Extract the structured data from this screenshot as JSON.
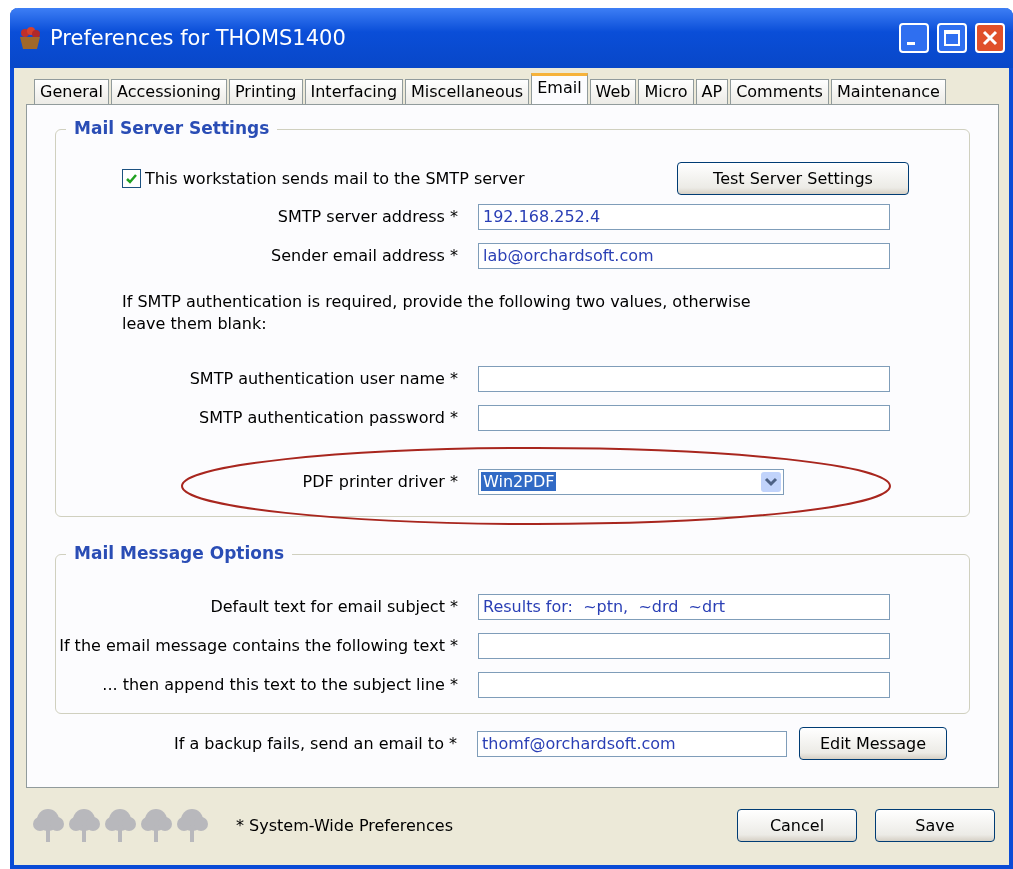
{
  "window": {
    "title": "Preferences for THOMS1400"
  },
  "tabs": [
    {
      "label": "General",
      "selected": false
    },
    {
      "label": "Accessioning",
      "selected": false
    },
    {
      "label": "Printing",
      "selected": false
    },
    {
      "label": "Interfacing",
      "selected": false
    },
    {
      "label": "Miscellaneous",
      "selected": false
    },
    {
      "label": "Email",
      "selected": true
    },
    {
      "label": "Web",
      "selected": false
    },
    {
      "label": "Micro",
      "selected": false
    },
    {
      "label": "AP",
      "selected": false
    },
    {
      "label": "Comments",
      "selected": false
    },
    {
      "label": "Maintenance",
      "selected": false
    }
  ],
  "mail_server_settings": {
    "title": "Mail Server Settings",
    "sends_mail": {
      "label": "This workstation sends mail to the SMTP server",
      "checked": true
    },
    "test_button": "Test Server Settings",
    "fields": [
      {
        "label": "SMTP server address *",
        "value": "192.168.252.4"
      },
      {
        "label": "Sender email address *",
        "value": "lab@orchardsoft.com"
      }
    ],
    "note": "If SMTP authentication is required, provide the following two values, otherwise leave them blank:",
    "auth_fields": [
      {
        "label": "SMTP authentication user name *"
      },
      {
        "label": "SMTP authentication password *"
      }
    ],
    "pdf_driver": {
      "label": "PDF printer driver *",
      "value": "Win2PDF",
      "highlighted": true
    }
  },
  "mail_message_options": {
    "title": "Mail Message Options",
    "fields": [
      {
        "label": "Default text for email subject *",
        "value": "Results for:  ~ptn,  ~drd  ~drt"
      },
      {
        "label": "If the email message contains the following text *"
      },
      {
        "label": "... then append this text to the subject line *"
      }
    ]
  },
  "backup": {
    "label": "If a backup fails, send an email to *",
    "value": "thomf@orchardsoft.com",
    "button": "Edit Message"
  },
  "footer": {
    "note": "* System-Wide Preferences",
    "buttons": [
      "Cancel",
      "Save"
    ]
  }
}
